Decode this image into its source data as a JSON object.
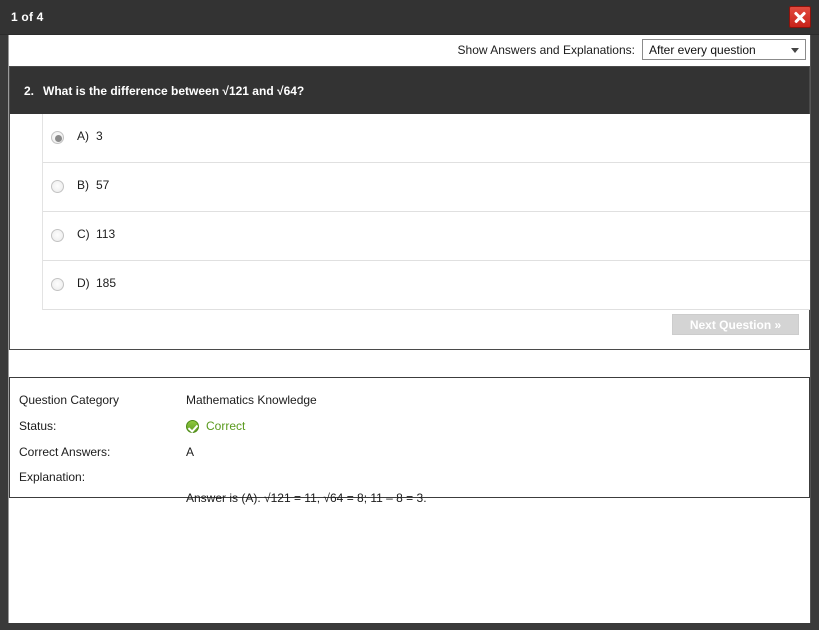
{
  "window": {
    "title": "1 of 4",
    "close_label": "×"
  },
  "toolbar": {
    "label": "Show Answers and Explanations:",
    "select_value": "After every question",
    "select_options": [
      "After every question"
    ]
  },
  "question": {
    "number": "2.",
    "text": "What is the difference between √121 and √64?",
    "options": [
      {
        "letter": "A)",
        "value": "3",
        "selected": true
      },
      {
        "letter": "B)",
        "value": "57",
        "selected": false
      },
      {
        "letter": "C)",
        "value": "113",
        "selected": false
      },
      {
        "letter": "D)",
        "value": "185",
        "selected": false
      }
    ],
    "next_button": "Next Question »"
  },
  "explanation": {
    "category_label": "Question Category",
    "category_value": "Mathematics Knowledge",
    "status_label": "Status:",
    "status_value": "Correct",
    "status_icon": "check-circle-icon",
    "correct_label": "Correct Answers:",
    "correct_value": "A",
    "explanation_label": "Explanation:",
    "explanation_value": "Answer is (A). √121 = 11, √64 = 8; 11 – 8 = 3."
  },
  "colors": {
    "titlebar": "#333333",
    "close": "#c8231a",
    "correct": "#5a9a1e",
    "frame": "#3a3a3a"
  }
}
